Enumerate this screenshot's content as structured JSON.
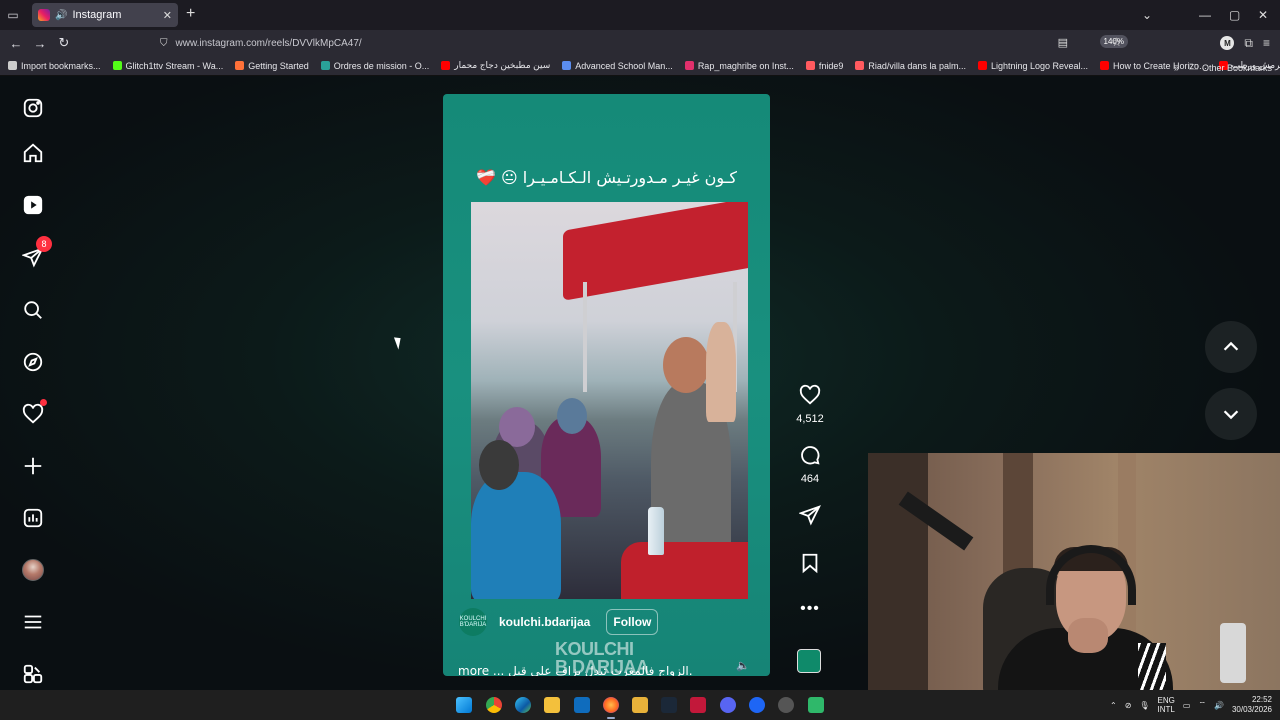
{
  "browser": {
    "tab_title": "Instagram",
    "url": "www.instagram.com/reels/DVVlkMpCA47/",
    "zoom": "140%",
    "profile_initial": "M",
    "bookmarks": [
      {
        "label": "Import bookmarks...",
        "color": "#cccccc"
      },
      {
        "label": "Glitch1ttv Stream - Wa...",
        "color": "#53fc18"
      },
      {
        "label": "Getting Started",
        "color": "#ff7139"
      },
      {
        "label": "Ordres de mission - O...",
        "color": "#2aa198"
      },
      {
        "label": "سين مطبخين دجاج محمار",
        "color": "#ff0000"
      },
      {
        "label": "Advanced School Man...",
        "color": "#5b8def"
      },
      {
        "label": "Rap_maghribe on Inst...",
        "color": "#e1306c"
      },
      {
        "label": "fnide9",
        "color": "#ff5a5f"
      },
      {
        "label": "Riad/villa dans la palm...",
        "color": "#ff5a5f"
      },
      {
        "label": "Lightning Logo Reveal...",
        "color": "#ff0000"
      },
      {
        "label": "How to Create Horizo...",
        "color": "#ff0000"
      },
      {
        "label": "سون حليب مقرمش ورطب",
        "color": "#ff0000"
      }
    ],
    "other_bookmarks": "Other Bookmarks"
  },
  "sidebar": {
    "messages_badge": "8"
  },
  "reel": {
    "top_caption": "كـون غيـر مـدورتـيش الـكـامـيـرا 😐 ❤️‍🩹",
    "username": "koulchi.bdarijaa",
    "follow_label": "Follow",
    "avatar_text": "KOULCHI B'DARIJA",
    "watermark_line1": "KOULCHI",
    "watermark_line2": "B DARIJAA",
    "description": "more ... الزواج فالمغرب تبدل بزاف على قبل.",
    "likes": "4,512",
    "comments": "464"
  },
  "taskbar": {
    "lang_top": "ENG",
    "lang_bottom": "INTL",
    "time": "22:52",
    "date": "30/03/2026"
  },
  "colors": {
    "reel_bg": "#19907f",
    "notification_red": "#ff3040",
    "page_bg": "#0a0f12"
  }
}
